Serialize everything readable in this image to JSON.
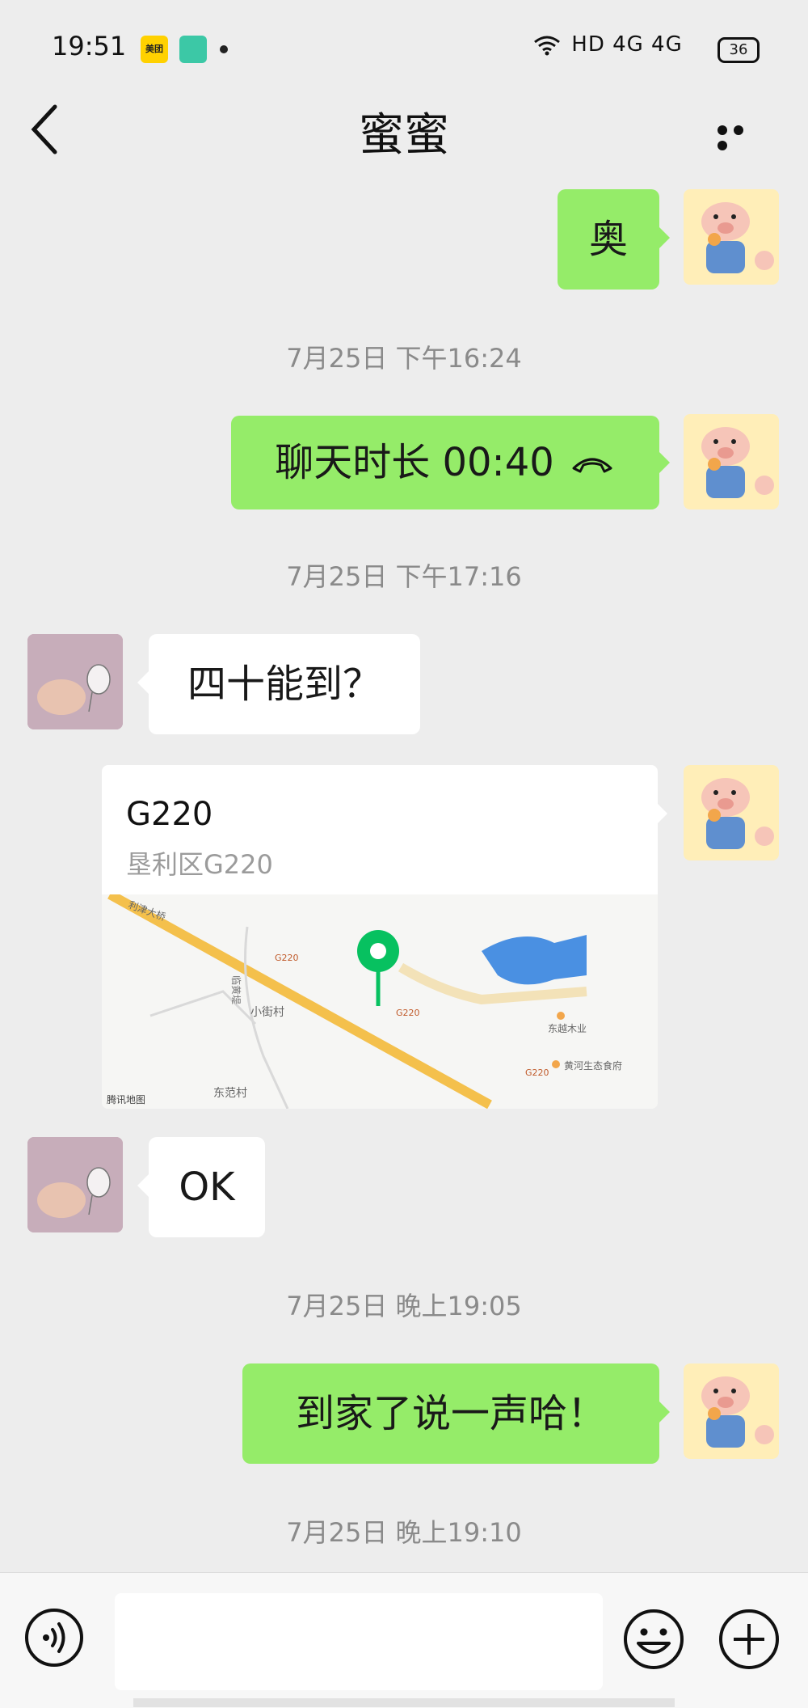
{
  "status_bar": {
    "time": "19:51",
    "app_badge_1": "美团",
    "network": "HD 4G 4G",
    "battery": "36"
  },
  "header": {
    "title": "蜜蜜",
    "back_icon": "chevron-left-icon",
    "more_icon": "more-dots-icon"
  },
  "messages": [
    {
      "sender": "me",
      "type": "text",
      "text": "奥"
    },
    {
      "type": "timestamp",
      "text": "7月25日 下午16:24"
    },
    {
      "sender": "me",
      "type": "call",
      "text": "聊天时长 00:40",
      "icon": "phone-hangup-icon"
    },
    {
      "type": "timestamp",
      "text": "7月25日 下午17:16"
    },
    {
      "sender": "them",
      "type": "text",
      "text": "四十能到？"
    },
    {
      "sender": "me",
      "type": "location",
      "title": "G220",
      "address": "垦利区G220"
    },
    {
      "sender": "them",
      "type": "text",
      "text": "OK"
    },
    {
      "type": "timestamp",
      "text": "7月25日 晚上19:05"
    },
    {
      "sender": "me",
      "type": "text",
      "text": "到家了说一声哈！"
    },
    {
      "type": "timestamp",
      "text": "7月25日 晚上19:10"
    }
  ],
  "map": {
    "labels": {
      "bridge": "利津大桥",
      "road1": "G220",
      "road2": "G220",
      "road3": "G220",
      "village1": "小街村",
      "village2": "东范村",
      "dike": "临黄堤",
      "poi1": "东越木业",
      "poi2": "黄河生态食府",
      "attribution": "腾讯地图"
    }
  },
  "colors": {
    "my_bubble": "#95ec69",
    "their_bubble": "#ffffff",
    "background": "#ededed",
    "map_pin": "#07c160",
    "map_road": "#f4c04c",
    "map_water": "#4a90e2"
  },
  "input_bar": {
    "voice_icon": "voice-icon",
    "emoji_icon": "emoji-icon",
    "plus_icon": "plus-icon",
    "input_value": ""
  }
}
